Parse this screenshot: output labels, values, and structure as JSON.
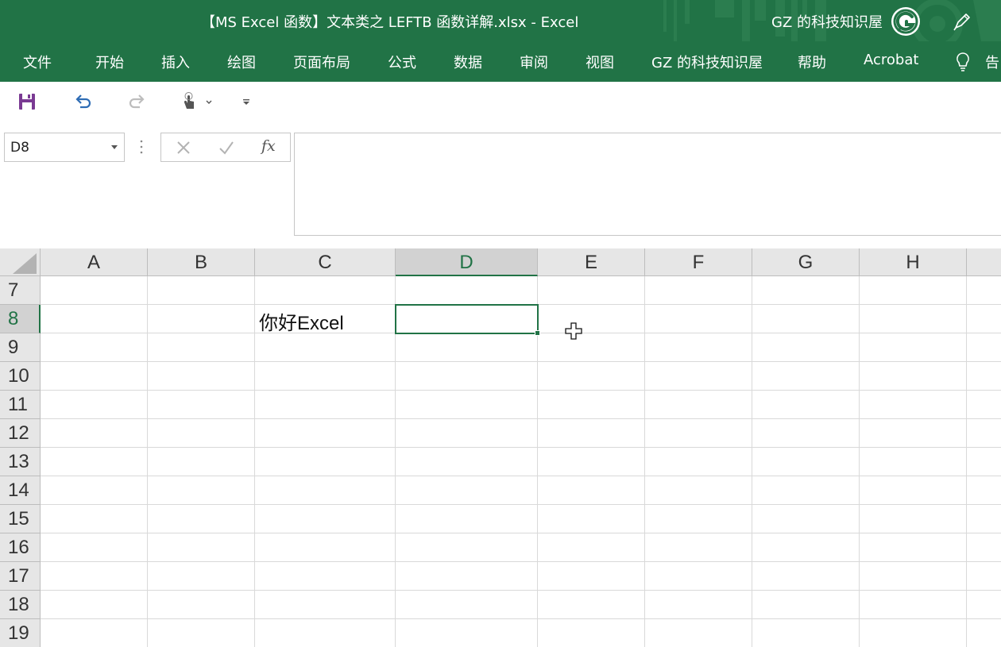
{
  "window": {
    "title": "【MS Excel 函数】文本类之 LEFTB 函数详解.xlsx  -  Excel",
    "account_name": "GZ 的科技知识屋",
    "colors": {
      "brand": "#217346",
      "header_bg": "#e6e6e6",
      "gridline": "#d9d9d9"
    }
  },
  "ribbon": {
    "tabs": [
      {
        "label": "文件"
      },
      {
        "label": "开始"
      },
      {
        "label": "插入"
      },
      {
        "label": "绘图"
      },
      {
        "label": "页面布局"
      },
      {
        "label": "公式"
      },
      {
        "label": "数据"
      },
      {
        "label": "审阅"
      },
      {
        "label": "视图"
      },
      {
        "label": "GZ 的科技知识屋"
      },
      {
        "label": "帮助"
      },
      {
        "label": "Acrobat"
      }
    ],
    "tell_me": "告"
  },
  "quick_access": {
    "icons": [
      "save-icon",
      "undo-icon",
      "redo-icon",
      "touch-mode-icon",
      "customize-icon"
    ]
  },
  "formula_bar": {
    "name_box": "D8",
    "fx_label": "fx",
    "formula": ""
  },
  "sheet": {
    "columns": [
      "A",
      "B",
      "C",
      "D",
      "E",
      "F",
      "G",
      "H"
    ],
    "rows": [
      "7",
      "8",
      "9",
      "10",
      "11",
      "12",
      "13",
      "14",
      "15",
      "16",
      "17",
      "18",
      "19"
    ],
    "active_column": "D",
    "active_row": "8",
    "cells": [
      {
        "ref": "C8",
        "value": "你好Excel"
      }
    ]
  }
}
